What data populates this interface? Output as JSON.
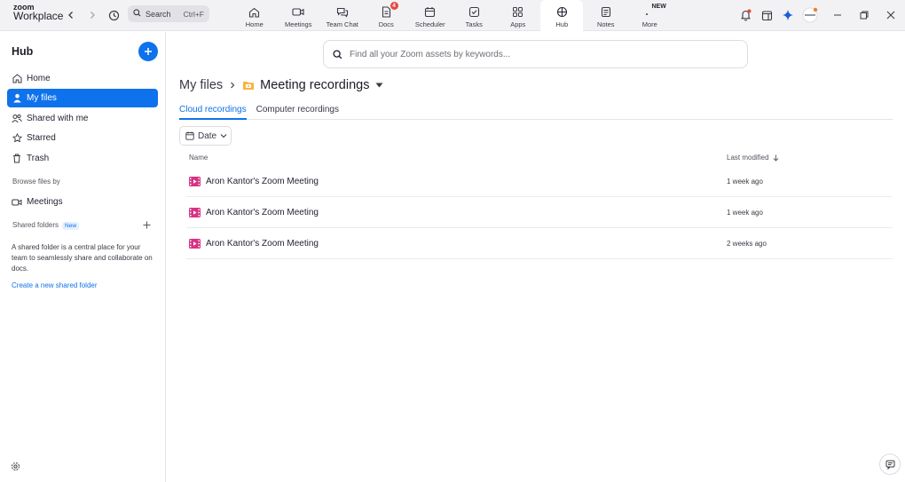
{
  "brand": {
    "line1": "zoom",
    "line2": "Workplace"
  },
  "search": {
    "label": "Search",
    "shortcut": "Ctrl+F"
  },
  "tabs": [
    {
      "label": "Home",
      "icon": "home-icon"
    },
    {
      "label": "Meetings",
      "icon": "video-icon"
    },
    {
      "label": "Team Chat",
      "icon": "chat-icon"
    },
    {
      "label": "Docs",
      "icon": "docs-icon",
      "badge": "4"
    },
    {
      "label": "Scheduler",
      "icon": "scheduler-icon"
    },
    {
      "label": "Tasks",
      "icon": "tasks-icon"
    },
    {
      "label": "Apps",
      "icon": "apps-icon"
    },
    {
      "label": "Hub",
      "icon": "hub-icon",
      "active": true
    },
    {
      "label": "Notes",
      "icon": "notes-icon"
    },
    {
      "label": "More",
      "icon": "more-icon",
      "badge": "NEW"
    }
  ],
  "sidebar": {
    "title": "Hub",
    "items": [
      {
        "label": "Home",
        "icon": "home-icon"
      },
      {
        "label": "My files",
        "icon": "person-icon",
        "active": true
      },
      {
        "label": "Shared with me",
        "icon": "people-icon"
      },
      {
        "label": "Starred",
        "icon": "star-icon"
      },
      {
        "label": "Trash",
        "icon": "trash-icon"
      }
    ],
    "browse_label": "Browse files by",
    "meetings_label": "Meetings",
    "shared_folders_label": "Shared folders",
    "new_badge": "New",
    "help_text": "A shared folder is a central place for your team to seamlessly share and collaborate on docs.",
    "create_link": "Create a new shared folder"
  },
  "main": {
    "search_placeholder": "Find all your Zoom assets by keywords...",
    "breadcrumb_root": "My files",
    "breadcrumb_current": "Meeting recordings",
    "subtabs": [
      "Cloud recordings",
      "Computer recordings"
    ],
    "date_filter": "Date",
    "columns": {
      "name": "Name",
      "modified": "Last modified"
    },
    "rows": [
      {
        "name": "Aron Kantor's Zoom Meeting",
        "modified": "1 week ago"
      },
      {
        "name": "Aron Kantor's Zoom Meeting",
        "modified": "1 week ago"
      },
      {
        "name": "Aron Kantor's Zoom Meeting",
        "modified": "2 weeks ago"
      }
    ]
  },
  "colors": {
    "accent": "#0e72ed",
    "recording": "#d63384",
    "badge": "#e8483f"
  }
}
